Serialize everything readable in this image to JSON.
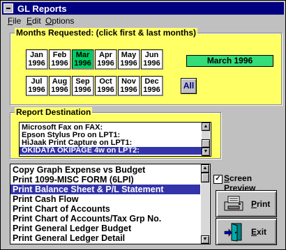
{
  "window": {
    "title": "GL Reports"
  },
  "menu": [
    "File",
    "Edit",
    "Options"
  ],
  "months_group": {
    "title": "Months Requested: (click first & last months)",
    "row1": [
      {
        "mon": "Jan",
        "year": "1996",
        "selected": false
      },
      {
        "mon": "Feb",
        "year": "1996",
        "selected": false
      },
      {
        "mon": "Mar",
        "year": "1996",
        "selected": true
      },
      {
        "mon": "Apr",
        "year": "1996",
        "selected": false
      },
      {
        "mon": "May",
        "year": "1996",
        "selected": false
      },
      {
        "mon": "Jun",
        "year": "1996",
        "selected": false
      }
    ],
    "row2": [
      {
        "mon": "Jul",
        "year": "1996",
        "selected": false
      },
      {
        "mon": "Aug",
        "year": "1996",
        "selected": false
      },
      {
        "mon": "Sep",
        "year": "1996",
        "selected": false
      },
      {
        "mon": "Oct",
        "year": "1996",
        "selected": false
      },
      {
        "mon": "Nov",
        "year": "1996",
        "selected": false
      },
      {
        "mon": "Dec",
        "year": "1996",
        "selected": false
      }
    ],
    "range_display": "March 1996",
    "all_button": "All"
  },
  "destination_group": {
    "title": "Report Destination",
    "items": [
      "Microsoft Fax on FAX:",
      "Epson Stylus Pro on LPT1:",
      "HiJaak Print Capture on LPT1:",
      "OKIDATA OKIPAGE 4w on LPT2:"
    ],
    "selected_index": 3
  },
  "reports": {
    "items": [
      "Copy Graph Expense vs Budget",
      "Print 1099-MISC FORM (6LPI)",
      "Print Balance Sheet & P/L Statement",
      "Print Cash Flow",
      "Print Chart of Accounts",
      "Print Chart of Accounts/Tax Grp No.",
      "Print General Ledger Budget",
      "Print General Ledger Detail"
    ],
    "selected_index": 2
  },
  "screen_preview": {
    "label": "Screen Preview",
    "checked": true
  },
  "buttons": {
    "print": "Print",
    "exit": "Exit"
  },
  "colors": {
    "title_bar": "#000080",
    "group_bg": "#ffff66",
    "month_selected": "#00cc66",
    "list_selected": "#3333aa"
  }
}
